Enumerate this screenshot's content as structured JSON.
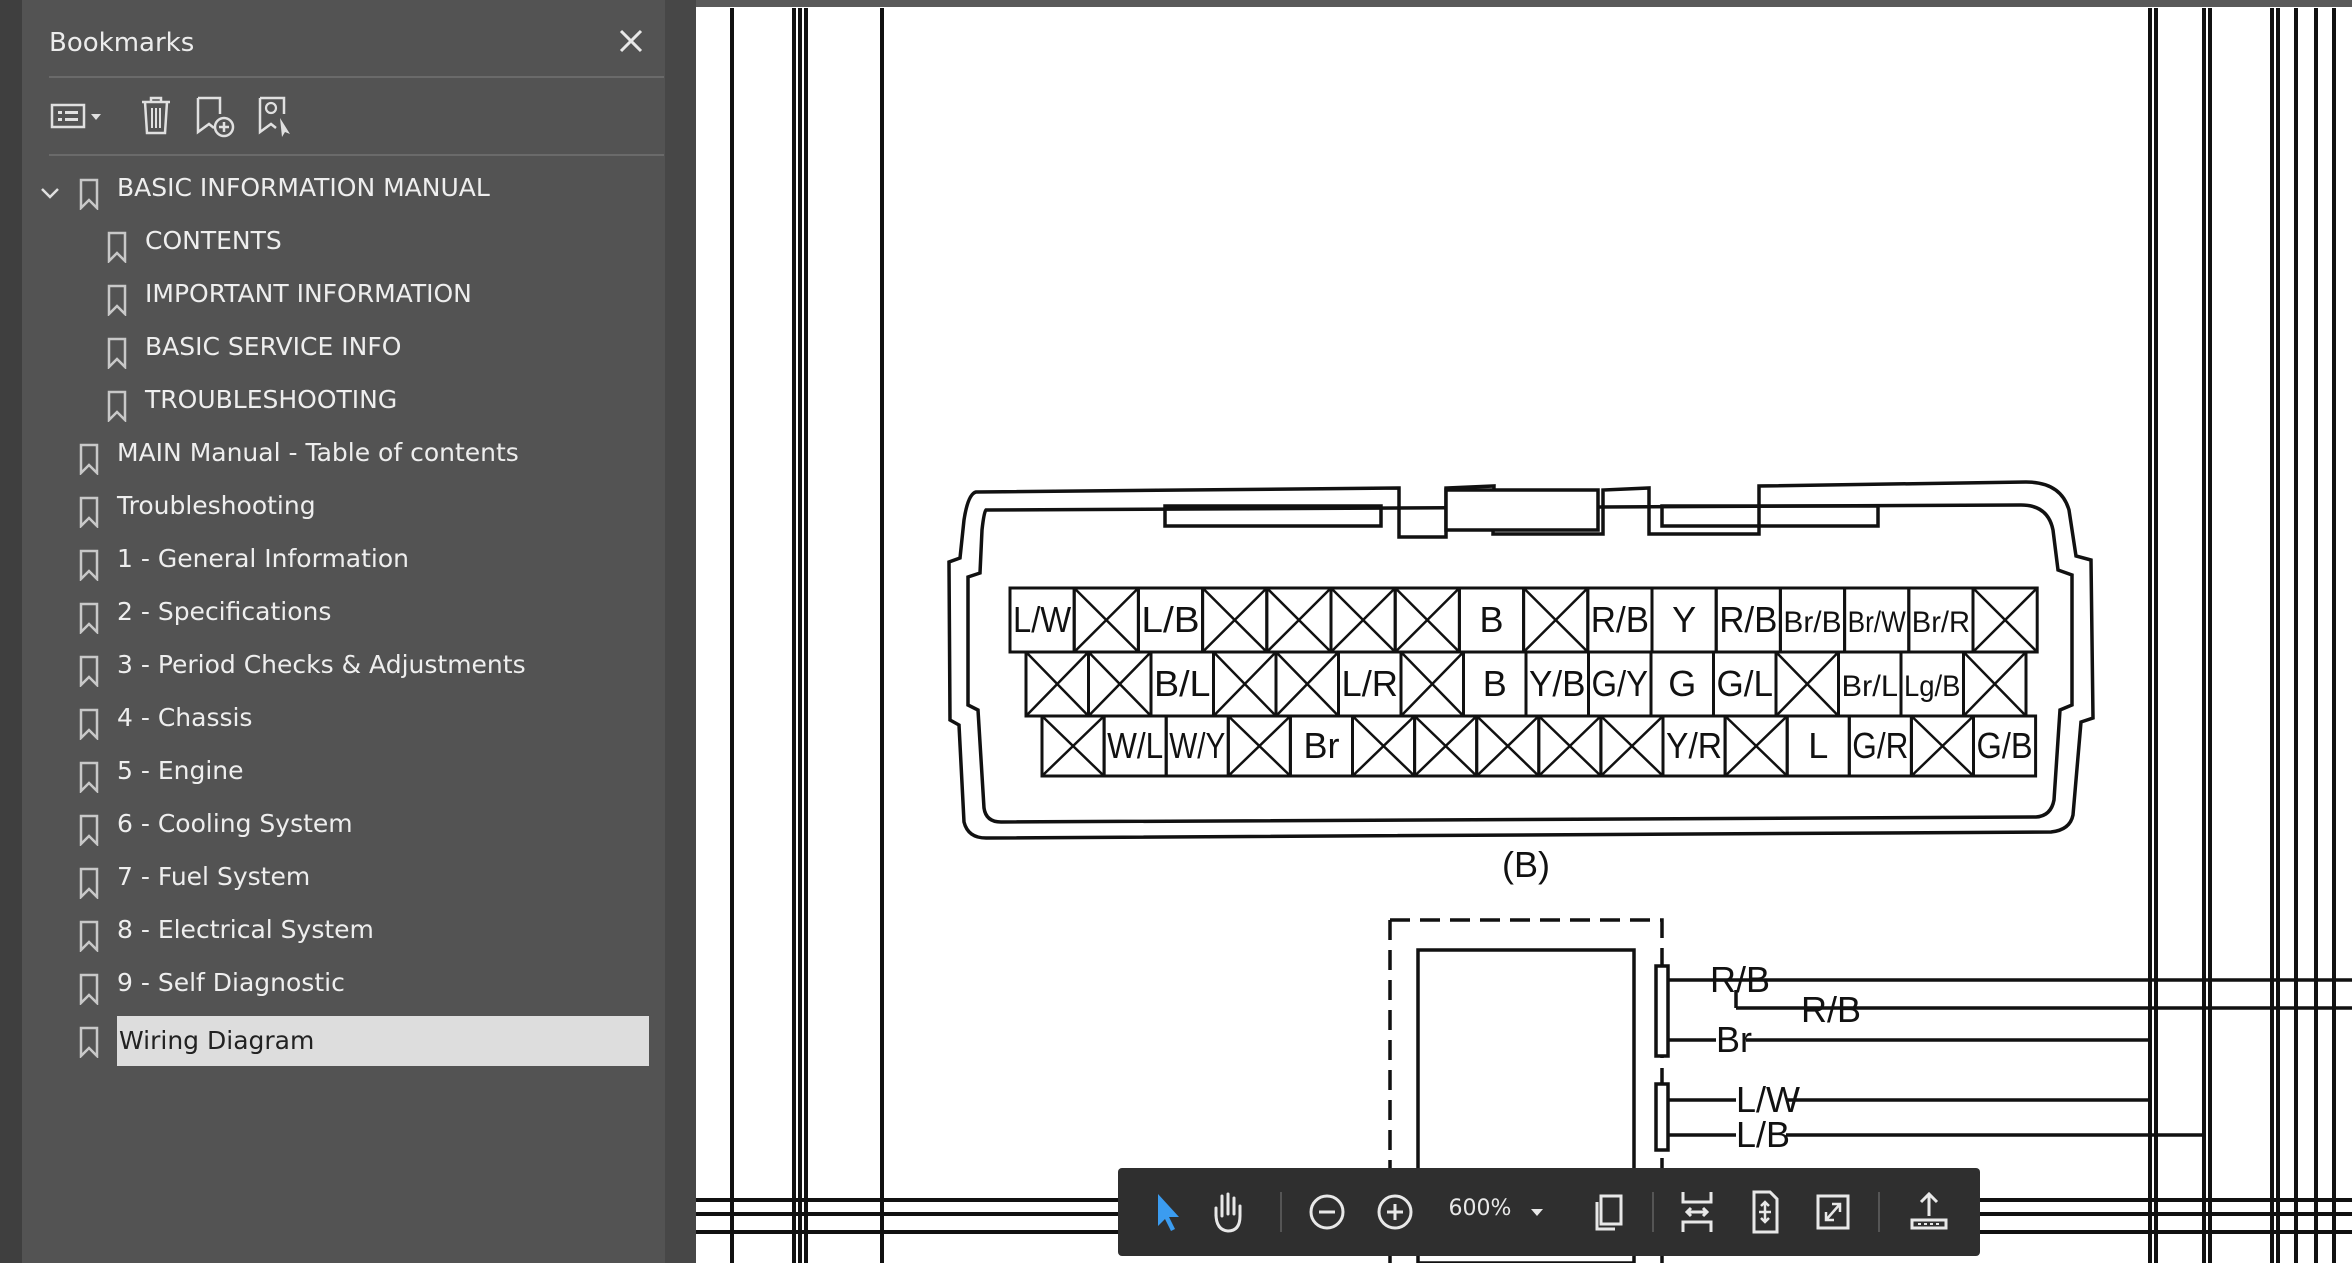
{
  "sidebar": {
    "title": "Bookmarks",
    "items": [
      {
        "label": "BASIC INFORMATION MANUAL",
        "level": 0,
        "expanded": true,
        "selected": false
      },
      {
        "label": "CONTENTS",
        "level": 1,
        "selected": false
      },
      {
        "label": "IMPORTANT INFORMATION",
        "level": 1,
        "selected": false
      },
      {
        "label": "BASIC SERVICE INFO",
        "level": 1,
        "selected": false
      },
      {
        "label": "TROUBLESHOOTING",
        "level": 1,
        "selected": false
      },
      {
        "label": "MAIN Manual - Table of contents",
        "level": 0,
        "selected": false
      },
      {
        "label": "Troubleshooting",
        "level": 0,
        "selected": false
      },
      {
        "label": "1 - General Information",
        "level": 0,
        "selected": false
      },
      {
        "label": "2 - Specifications",
        "level": 0,
        "selected": false
      },
      {
        "label": "3 - Period Checks & Adjustments",
        "level": 0,
        "selected": false
      },
      {
        "label": "4 - Chassis",
        "level": 0,
        "selected": false
      },
      {
        "label": "5 - Engine",
        "level": 0,
        "selected": false
      },
      {
        "label": "6 - Cooling System",
        "level": 0,
        "selected": false
      },
      {
        "label": "7 - Fuel System",
        "level": 0,
        "selected": false
      },
      {
        "label": "8 - Electrical System",
        "level": 0,
        "selected": false
      },
      {
        "label": "9 - Self Diagnostic",
        "level": 0,
        "selected": false
      },
      {
        "label": "Wiring Diagram",
        "level": 0,
        "selected": true
      }
    ]
  },
  "toolbar": {
    "zoom": "600%"
  },
  "diagram": {
    "connector_label": "(B)",
    "row1": [
      "L/W",
      "X",
      "L/B",
      "X",
      "X",
      "X",
      "X",
      "B",
      "X",
      "R/B",
      "Y",
      "R/B",
      "Br/B",
      "Br/W",
      "Br/R",
      "X"
    ],
    "row2": [
      "X",
      "X",
      "B/L",
      "X",
      "X",
      "L/R",
      "X",
      "B",
      "Y/B",
      "G/Y",
      "G",
      "G/L",
      "X",
      "Br/L",
      "Lg/B",
      "X"
    ],
    "row3": [
      "X",
      "W/L",
      "W/Y",
      "X",
      "Br",
      "X",
      "X",
      "X",
      "X",
      "X",
      "Y/R",
      "X",
      "L",
      "G/R",
      "X",
      "G/B"
    ],
    "wires": [
      "R/B",
      "R/B",
      "Br",
      "L/W",
      "L/B"
    ]
  },
  "colors": {
    "panel": "#535353",
    "selected_row": "#dddddd",
    "pointer_accent": "#3b9cf0"
  }
}
